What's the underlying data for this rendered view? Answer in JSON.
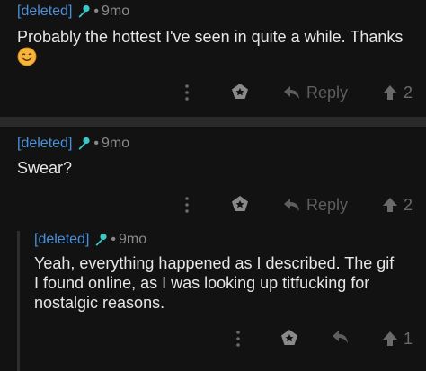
{
  "comments": [
    {
      "author": "[deleted]",
      "dot": "•",
      "age": "9mo",
      "body": "Probably the hottest I've seen in quite a while. Thanks",
      "emoji": "smiling-face-emoji",
      "reply_label": "Reply",
      "votes": "2"
    },
    {
      "author": "[deleted]",
      "dot": "•",
      "age": "9mo",
      "body": "Swear?",
      "reply_label": "Reply",
      "votes": "2"
    },
    {
      "author": "[deleted]",
      "dot": "•",
      "age": "9mo",
      "body_lines": [
        "Yeah, everything happened as I described. The gif",
        "I found online, as I was looking up titfucking for",
        "nostalgic reasons."
      ],
      "votes": "1"
    }
  ],
  "colors": {
    "background": "#121212",
    "author": "#4a90d9",
    "mic_icon": "#3cc8c8",
    "meta": "#8a8a8a",
    "body": "#e6e6e6",
    "action": "#5e5e5e",
    "divider": "#2a2a2a"
  },
  "icons": {
    "flair": "microphone-icon",
    "more": "more-vertical-icon",
    "award": "award-icon",
    "reply": "reply-arrow-icon",
    "upvote": "upvote-arrow-icon"
  }
}
